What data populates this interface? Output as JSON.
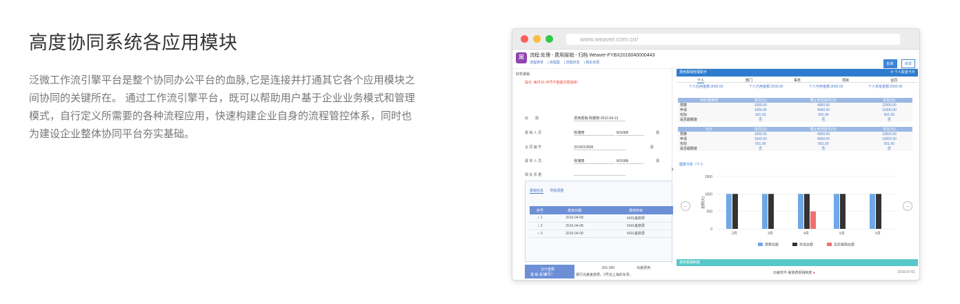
{
  "intro": {
    "title": "高度协同系统各应用模块",
    "description": "泛微工作流引擎平台是整个协同办公平台的血脉,它是连接并打通其它各个应用模块之间协同的关键所在。 通过工作流引擎平台，既可以帮助用户基于企业业务模式和管理模式，自行定义所需要的各种流程应用，快速构建企业自身的流程管控体系，同时也为建设企业整体协同平台夯实基础。"
  },
  "browser": {
    "url": "www.weaver.com.cn/"
  },
  "app": {
    "logo": "ꕤ",
    "title": "流程:处理 - 费用报销 - 归档 Weaver-FYBX2016040000443",
    "subnav": [
      "流程表单",
      "流程图",
      "流程状态",
      "相关资源"
    ],
    "buttons": {
      "primary": "批准",
      "secondary": "转发"
    }
  },
  "form": {
    "panel_title": "财务报销",
    "warning": "提示: 每月26-28号不能提交报销单!",
    "rows": [
      {
        "label": "标　　题",
        "value": "费用报销-陈雅丽-2016-04-13",
        "extra_label": "",
        "extra_value": ""
      },
      {
        "label": "报 销 人 员",
        "value": "陈雅丽",
        "extra_label": "",
        "extra_value": "WS098i"
      },
      {
        "label": "合 同 编 号",
        "value": "2016010838",
        "extra_label": "",
        "extra_value": ""
      },
      {
        "label": "报 单 人 员",
        "value": "陈雅丽",
        "extra_label": "",
        "extra_value": "WS098i"
      },
      {
        "label": "相 关 票 据",
        "value": "",
        "extra_label": "",
        "extra_value": ""
      }
    ],
    "side_marks": [
      "报",
      "报",
      "报"
    ],
    "detail_tabs": [
      "报销信息",
      "导航调整"
    ],
    "detail_headers": [
      "序号",
      "费用日期",
      "费用科目"
    ],
    "detail_rows": [
      {
        "no": "1",
        "date": "2016-04-08",
        "item": "6431差旅费"
      },
      {
        "no": "2",
        "date": "2016-04-08",
        "item": "6431差旅费"
      },
      {
        "no": "3",
        "date": "2016-04-08",
        "item": "6431差旅费"
      }
    ],
    "sum_label": "合计金额\n（大写）",
    "sum_value": "831.000",
    "sum_extra": "出差费用",
    "reason_label": "报 销 事 由:",
    "reason_value": "银行出差差旅费。3号出上海的车票。"
  },
  "dashboard": {
    "title": "费用报销管理助手",
    "right_action": "个人股金卡片",
    "tabs": [
      "个人",
      "部门",
      "事务",
      "项目",
      "合同"
    ],
    "summary": [
      "个人应用金额:3000.00",
      "个人已用金额:2000.00",
      "个人可用金额:3000.00",
      "个人未批金额:2000.00"
    ],
    "table1": {
      "headers": [
        "8001费用项",
        "本月(元)",
        "截止到当前月(元)",
        "本年(元)"
      ],
      "rows": [
        [
          "预算",
          "1000.00",
          "4000.00",
          "12000.00"
        ],
        [
          "申请",
          "1000.00",
          "4000.00",
          "12000.00"
        ],
        [
          "实际",
          "501.00",
          "501.00",
          "501.00"
        ],
        [
          "是否超额度",
          "否",
          "否",
          "否"
        ]
      ]
    },
    "table2": {
      "headers": [
        "合计",
        "本月(元)",
        "截止到当前月(元)",
        "本年(元)"
      ],
      "rows": [
        [
          "预算",
          "1000.00",
          "4000.00",
          "12000.00"
        ],
        [
          "申请",
          "1000.00",
          "4000.00",
          "12000.00"
        ],
        [
          "实际",
          "501.00",
          "501.00",
          "501.00"
        ],
        [
          "是否超额度",
          "否",
          "否",
          "否"
        ]
      ]
    },
    "chart_label": "图表分析（个人",
    "footer_title": "费用报销制度",
    "footer_item": "出差软件 差旅费报销制度",
    "footer_date": "2016-07-01"
  },
  "chart_data": {
    "type": "bar",
    "categories": [
      "2月",
      "3月",
      "4月",
      "5月",
      "6月"
    ],
    "series": [
      {
        "name": "预算总额",
        "color": "#6fa8e6",
        "values": [
          1000,
          1000,
          1000,
          1000,
          1000
        ]
      },
      {
        "name": "申请总额",
        "color": "#333333",
        "values": [
          1000,
          1000,
          1000,
          1000,
          1000
        ]
      },
      {
        "name": "实际报销总额",
        "color": "#f07070",
        "values": [
          0,
          0,
          501,
          0,
          0
        ]
      }
    ],
    "yticks": [
      0,
      500,
      1000,
      1500
    ],
    "ylabel": "金额(元)",
    "ylim": [
      0,
      1500
    ],
    "legend": "bottom"
  }
}
